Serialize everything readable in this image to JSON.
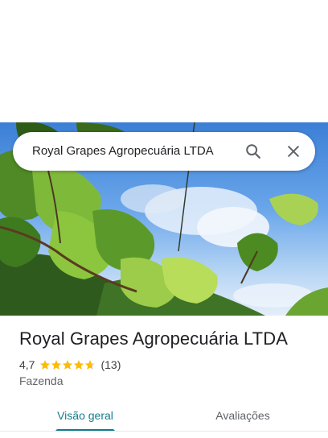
{
  "search": {
    "query": "Royal Grapes Agropecuária LTDA",
    "search_icon": "search-icon",
    "close_icon": "close-icon"
  },
  "hero": {
    "image": "vineyard-grape-leaves-photo"
  },
  "place": {
    "name": "Royal Grapes Agropecuária LTDA",
    "rating": "4,7",
    "rating_value": 4.7,
    "rating_max": 5,
    "review_count": "(13)",
    "category": "Fazenda"
  },
  "tabs": [
    {
      "label": "Visão geral",
      "active": true
    },
    {
      "label": "Avaliações",
      "active": false
    }
  ],
  "colors": {
    "accent": "#137c8c",
    "star": "#fbbc04",
    "star_empty": "#dadce0"
  }
}
